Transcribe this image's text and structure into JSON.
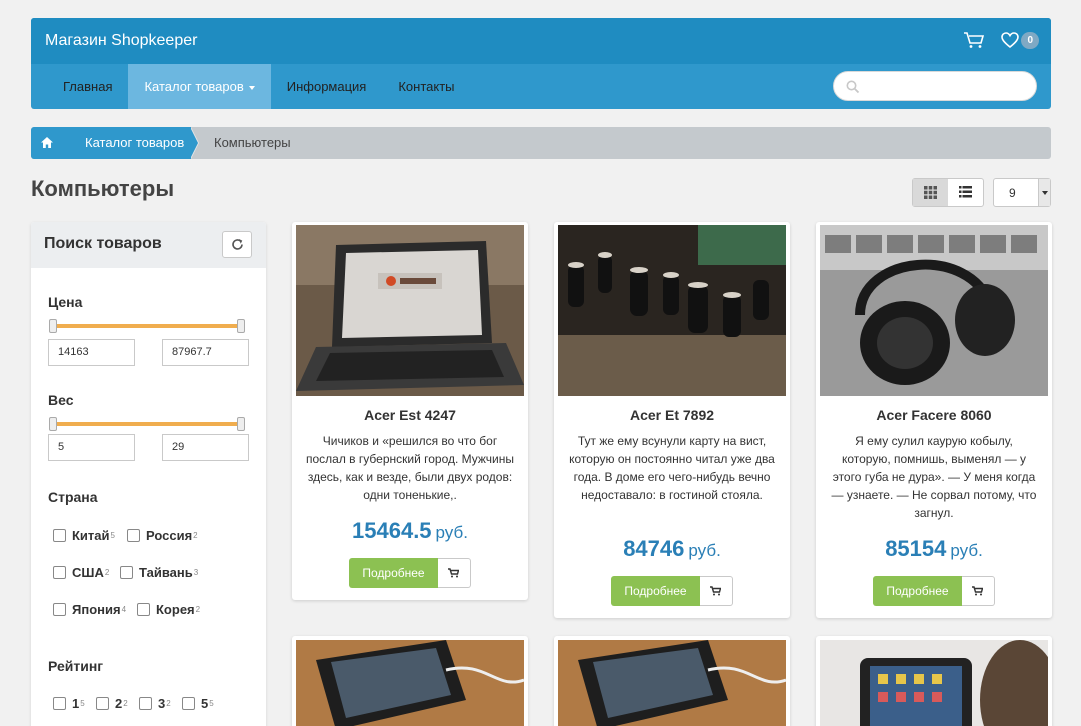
{
  "header": {
    "brand": "Магазин Shopkeeper",
    "favorites_count": "0",
    "nav": [
      "Главная",
      "Каталог товаров",
      "Информация",
      "Контакты"
    ],
    "search_placeholder": ""
  },
  "breadcrumb": {
    "home_icon": "home-icon",
    "catalog": "Каталог товаров",
    "current": "Компьютеры"
  },
  "page": {
    "title": "Компьютеры",
    "per_page": "9"
  },
  "filter": {
    "title": "Поиск товаров",
    "price": {
      "label": "Цена",
      "min": "14163",
      "max": "87967.7"
    },
    "weight": {
      "label": "Вес",
      "min": "5",
      "max": "29"
    },
    "country": {
      "label": "Страна",
      "options": [
        {
          "name": "Китай",
          "count": "5"
        },
        {
          "name": "Россия",
          "count": "2"
        },
        {
          "name": "США",
          "count": "2"
        },
        {
          "name": "Тайвань",
          "count": "3"
        },
        {
          "name": "Япония",
          "count": "4"
        },
        {
          "name": "Корея",
          "count": "2"
        }
      ]
    },
    "rating": {
      "label": "Рейтинг",
      "options": [
        {
          "name": "1",
          "count": "5"
        },
        {
          "name": "2",
          "count": "2"
        },
        {
          "name": "3",
          "count": "2"
        },
        {
          "name": "5",
          "count": "5"
        }
      ]
    }
  },
  "products": [
    {
      "name": "Acer Est 4247",
      "description": "Чичиков и «решился во что бог послал в губернский город. Мужчины здесь, как и везде, были двух родов: одни тоненькие,.",
      "price": "15464.5",
      "currency": "руб.",
      "more_label": "Подробнее"
    },
    {
      "name": "Acer Et 7892",
      "description": "Тут же ему всунули карту на вист, которую он постоянно читал уже два года. В доме его чего-нибудь вечно недоставало: в гостиной стояла.",
      "price": "84746",
      "currency": "руб.",
      "more_label": "Подробнее"
    },
    {
      "name": "Acer Facere 8060",
      "description": "Я ему сулил каурую кобылу, которую, помнишь, выменял — у этого губа не дура». — У меня когда — узнаете. — Не сорвал потому, что загнул.",
      "price": "85154",
      "currency": "руб.",
      "more_label": "Подробнее"
    }
  ]
}
